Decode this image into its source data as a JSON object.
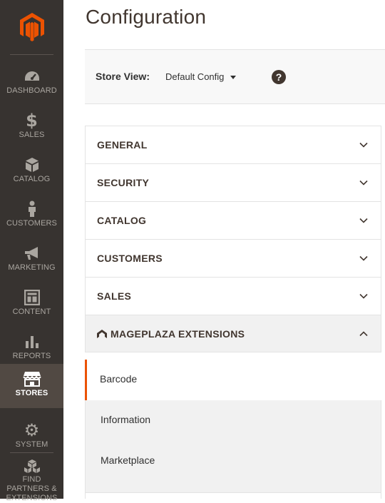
{
  "sidebar": {
    "logo": "magento-logo",
    "items": [
      {
        "label": "DASHBOARD",
        "icon": "speedometer-icon"
      },
      {
        "label": "SALES",
        "icon": "dollar-icon"
      },
      {
        "label": "CATALOG",
        "icon": "box-icon"
      },
      {
        "label": "CUSTOMERS",
        "icon": "person-icon"
      },
      {
        "label": "MARKETING",
        "icon": "megaphone-icon"
      },
      {
        "label": "CONTENT",
        "icon": "layout-icon"
      },
      {
        "label": "REPORTS",
        "icon": "bar-chart-icon"
      },
      {
        "label": "STORES",
        "icon": "store-icon",
        "active": true
      },
      {
        "label": "SYSTEM",
        "icon": "gear-icon"
      },
      {
        "label": "FIND PARTNERS & EXTENSIONS",
        "icon": "cubes-icon"
      }
    ]
  },
  "page": {
    "title": "Configuration"
  },
  "scope": {
    "label": "Store View:",
    "value": "Default Config",
    "help": "?"
  },
  "tabs": [
    {
      "label": "GENERAL"
    },
    {
      "label": "SECURITY"
    },
    {
      "label": "CATALOG"
    },
    {
      "label": "CUSTOMERS"
    },
    {
      "label": "SALES"
    },
    {
      "label": "MAGEPLAZA EXTENSIONS",
      "open": true
    }
  ],
  "subitems": [
    {
      "label": "Barcode",
      "active": true
    },
    {
      "label": "Information"
    },
    {
      "label": "Marketplace"
    }
  ],
  "colors": {
    "sidebar_bg": "#373330",
    "sidebar_active": "#514943",
    "accent": "#eb5202",
    "logo": "#eb5202"
  }
}
